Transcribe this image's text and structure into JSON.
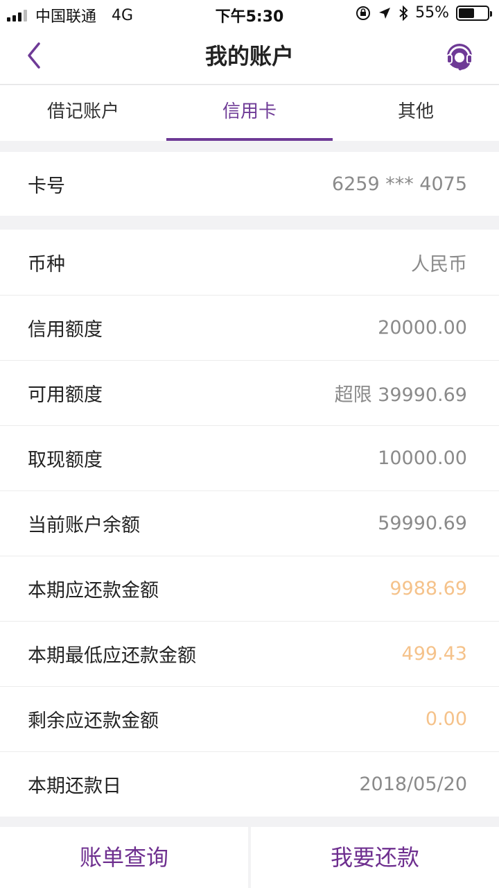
{
  "status_bar": {
    "carrier": "中国联通",
    "network": "4G",
    "time": "下午5:30",
    "battery": "55%",
    "battery_level": 0.55
  },
  "header": {
    "title": "我的账户",
    "back_icon": "chevron-left-icon",
    "service_icon": "customer-service-icon",
    "accent_color": "#6e3a96"
  },
  "tabs": [
    {
      "label": "借记账户",
      "active": false
    },
    {
      "label": "信用卡",
      "active": true
    },
    {
      "label": "其他",
      "active": false
    }
  ],
  "card": {
    "label": "卡号",
    "value": "6259 *** 4075"
  },
  "details": [
    {
      "label": "币种",
      "value": "人民币"
    },
    {
      "label": "信用额度",
      "value": "20000.00"
    },
    {
      "label": "可用额度",
      "value": "超限 39990.69"
    },
    {
      "label": "取现额度",
      "value": "10000.00"
    },
    {
      "label": "当前账户余额",
      "value": "59990.69"
    },
    {
      "label": "本期应还款金额",
      "value": "9988.69"
    },
    {
      "label": "本期最低应还款金额",
      "value": "499.43"
    },
    {
      "label": "剩余应还款金额",
      "value": "0.00"
    },
    {
      "label": "本期还款日",
      "value": "2018/05/20"
    }
  ],
  "highlight_color": "#f5c28a",
  "bottom_buttons": {
    "bill_query": "账单查询",
    "repay": "我要还款"
  }
}
